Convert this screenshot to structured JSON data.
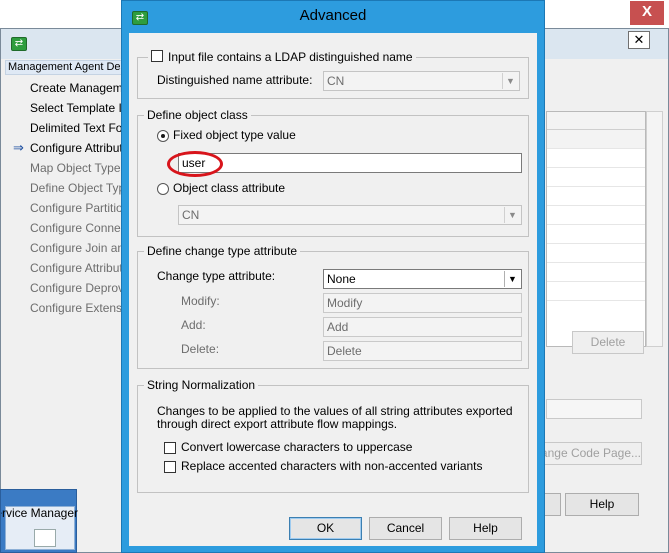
{
  "background_window": {
    "header": "Management Agent Designer",
    "nav_items": [
      {
        "label": "Create Management Agent",
        "state": "normal"
      },
      {
        "label": "Select Template Input File",
        "state": "normal"
      },
      {
        "label": "Delimited Text Format",
        "state": "normal"
      },
      {
        "label": "Configure Attributes",
        "state": "current"
      },
      {
        "label": "Map Object Types",
        "state": "dim"
      },
      {
        "label": "Define Object Types",
        "state": "dim"
      },
      {
        "label": "Configure Partitions",
        "state": "dim"
      },
      {
        "label": "Configure Connector Filter",
        "state": "dim"
      },
      {
        "label": "Configure Join and Projection Rules",
        "state": "dim"
      },
      {
        "label": "Configure Attribute Flow",
        "state": "dim"
      },
      {
        "label": "Configure Deprovisioning",
        "state": "dim"
      },
      {
        "label": "Configure Extensions",
        "state": "dim"
      }
    ],
    "delete_button": "Delete",
    "code_page_button": "Change Code Page...",
    "help_button": "Help",
    "taskbar_label": "Synchronization Service Manager"
  },
  "dialog": {
    "title": "Advanced",
    "ldap": {
      "checkbox_label": "Input file contains a LDAP distinguished name",
      "checked": false,
      "dn_attribute_label": "Distinguished name attribute:",
      "dn_attribute_value": "CN"
    },
    "object_class": {
      "legend": "Define object class",
      "fixed_label": "Fixed object type value",
      "fixed_selected": true,
      "fixed_value": "user",
      "attribute_label": "Object class attribute",
      "attribute_value": "CN"
    },
    "change_type": {
      "legend": "Define change type attribute",
      "attribute_label": "Change type attribute:",
      "attribute_value": "None",
      "modify_label": "Modify:",
      "modify_value": "Modify",
      "add_label": "Add:",
      "add_value": "Add",
      "delete_label": "Delete:",
      "delete_value": "Delete"
    },
    "normalization": {
      "legend": "String Normalization",
      "description_line1": "Changes to be applied to the values of all string attributes exported",
      "description_line2": "through direct export attribute flow mappings.",
      "uppercase_label": "Convert lowercase characters to uppercase",
      "uppercase_checked": false,
      "accents_label": "Replace accented characters with non-accented variants",
      "accents_checked": false
    },
    "buttons": {
      "ok": "OK",
      "cancel": "Cancel",
      "help": "Help"
    },
    "close_glyph": "X"
  },
  "icons": [
    "app-icon",
    "close-icon",
    "current-step-arrow-icon",
    "dropdown-arrow-icon"
  ],
  "colors": {
    "dialog_frame": "#2d9cde",
    "close_button": "#c75050",
    "highlight": "#d8141b"
  }
}
